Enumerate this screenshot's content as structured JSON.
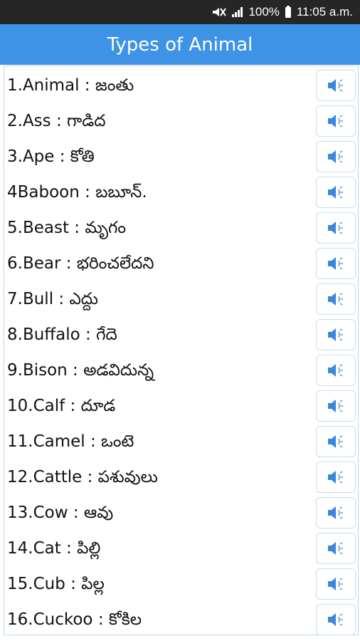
{
  "status_bar": {
    "battery": "100%",
    "time": "11:05 a.m."
  },
  "app_bar": {
    "title": "Types of Animal"
  },
  "items": [
    {
      "label": "1.Animal : జంతు"
    },
    {
      "label": "2.Ass : గాడిద"
    },
    {
      "label": "3.Ape : కోతి"
    },
    {
      "label": "4Baboon : బబూన్."
    },
    {
      "label": "5.Beast : మృగం"
    },
    {
      "label": "6.Bear : భరించలేదని"
    },
    {
      "label": "7.Bull : ఎద్దు"
    },
    {
      "label": "8.Buffalo : గేదె"
    },
    {
      "label": "9.Bison : అడవిదున్న"
    },
    {
      "label": "10.Calf : దూడ"
    },
    {
      "label": "11.Camel : ఒంటె"
    },
    {
      "label": "12.Cattle : పశువులు"
    },
    {
      "label": "13.Cow : ఆవు"
    },
    {
      "label": "14.Cat : పిల్లి"
    },
    {
      "label": "15.Cub : పిల్ల"
    },
    {
      "label": "16.Cuckoo : కోకిల"
    }
  ],
  "icons": {
    "speaker": "speaker-icon"
  },
  "colors": {
    "app_bar": "#3e93e6",
    "speaker": "#3b87d9",
    "status_bar": "#262626"
  }
}
